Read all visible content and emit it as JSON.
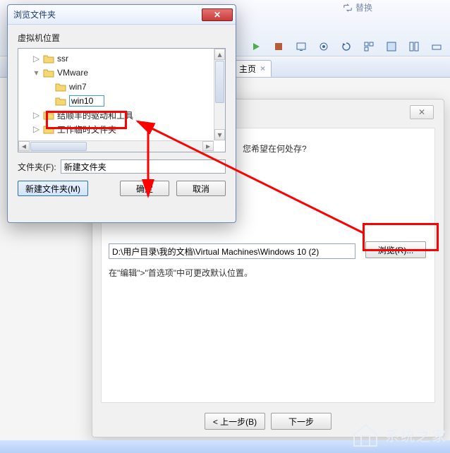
{
  "toolbar": {
    "replace_label": "替换"
  },
  "tab": {
    "label": "主页"
  },
  "wizard": {
    "close_glyph": "✕",
    "question": "您希望在何处存?",
    "path_value": "D:\\用户目录\\我的文档\\Virtual Machines\\Windows 10 (2)",
    "browse_label": "浏览(R)...",
    "help_text": "在\"编辑\">\"首选项\"中可更改默认位置。",
    "back_label": "< 上一步(B)",
    "next_label": "下一步"
  },
  "dialog": {
    "title": "浏览文件夹",
    "subtitle": "虚拟机位置",
    "tree": {
      "ssr": "ssr",
      "vmware": "VMware",
      "win7": "win7",
      "win10_value": "win10",
      "node4": "结顺丰的驱动和工具",
      "node5": "工作临时文件夹"
    },
    "folder_label": "文件夹(F):",
    "folder_value": "新建文件夹",
    "new_folder_label": "新建文件夹(M)",
    "ok_label": "确定",
    "cancel_label": "取消"
  },
  "watermark": {
    "text": "系统之家"
  }
}
